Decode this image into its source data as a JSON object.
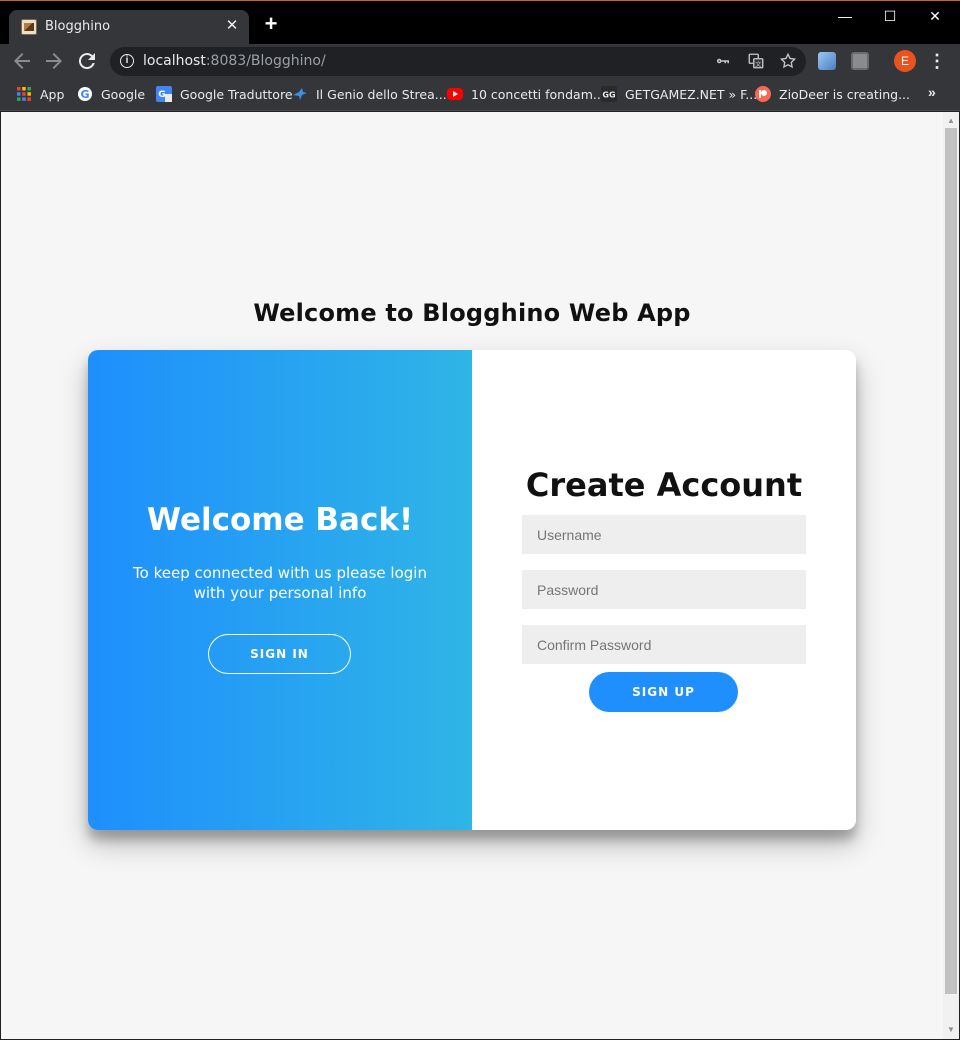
{
  "browser": {
    "tab_title": "Blogghino",
    "tab_close": "✕",
    "new_tab": "+",
    "window_controls": {
      "minimize": "—",
      "maximize": "☐",
      "close": "✕"
    },
    "url_host": "localhost",
    "url_rest": ":8083/Blogghino/",
    "profile_initial": "E",
    "icons": [
      "back-arrow-icon",
      "forward-arrow-icon",
      "reload-icon",
      "info-icon",
      "key-icon",
      "translate-icon",
      "star-icon",
      "extension-icon",
      "menu-icon"
    ],
    "bookmarks": [
      {
        "label": "App",
        "icon": "apps-grid-icon"
      },
      {
        "label": "Google",
        "icon": "google-icon"
      },
      {
        "label": "Google Traduttore",
        "icon": "google-translate-icon"
      },
      {
        "label": "Il Genio dello Strea...",
        "icon": "bird-icon"
      },
      {
        "label": "10 concetti fondam...",
        "icon": "youtube-icon"
      },
      {
        "label": "GETGAMEZ.NET » F...",
        "icon": "getgamez-icon"
      },
      {
        "label": "ZioDeer is creating...",
        "icon": "patreon-icon"
      }
    ],
    "bookmarks_more": "»"
  },
  "page": {
    "heading": "Welcome to Blogghino Web App",
    "overlay": {
      "title": "Welcome Back!",
      "text": "To keep connected with us please login with your personal info",
      "button": "SIGN IN"
    },
    "form": {
      "title": "Create Account",
      "username_placeholder": "Username",
      "password_placeholder": "Password",
      "confirm_placeholder": "Confirm Password",
      "button": "SIGN UP"
    }
  },
  "colors": {
    "accent": "#1e8ffd",
    "gradient_start": "#1e8ffd",
    "gradient_end": "#2fb5e6",
    "page_background": "#f6f6f7"
  }
}
